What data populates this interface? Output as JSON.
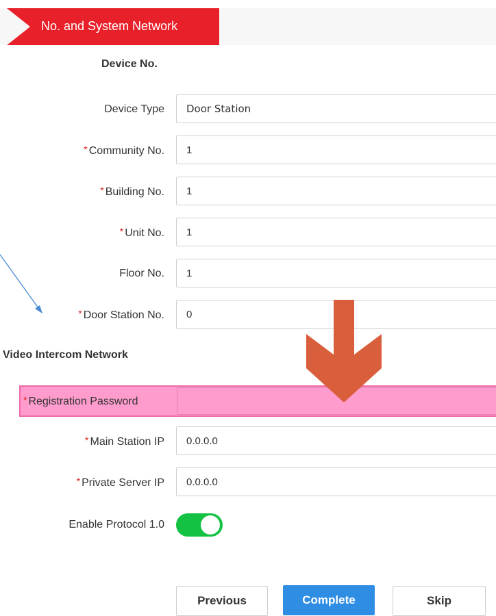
{
  "header": {
    "title": "No. and System Network",
    "accent_color": "#e8202a"
  },
  "device_no": {
    "section_title": "Device No.",
    "fields": [
      {
        "label": "Device Type",
        "required": false,
        "value": "Door Station"
      },
      {
        "label": "Community No.",
        "required": true,
        "value": "1"
      },
      {
        "label": "Building No.",
        "required": true,
        "value": "1"
      },
      {
        "label": "Unit No.",
        "required": true,
        "value": "1"
      },
      {
        "label": "Floor No.",
        "required": false,
        "value": "1"
      },
      {
        "label": "Door Station No.",
        "required": true,
        "value": "0"
      }
    ]
  },
  "video_intercom": {
    "section_title": "Video Intercom Network",
    "registration_password": {
      "label": "Registration Password",
      "required": true,
      "value": ""
    },
    "main_station_ip": {
      "label": "Main Station IP",
      "required": true,
      "value": "0.0.0.0"
    },
    "private_server_ip": {
      "label": "Private Server IP",
      "required": true,
      "value": "0.0.0.0"
    },
    "enable_protocol": {
      "label": "Enable Protocol 1.0",
      "enabled": true
    }
  },
  "required_marker": "*",
  "buttons": {
    "previous": "Previous",
    "complete": "Complete",
    "skip": "Skip"
  },
  "annotations": {
    "highlight_color": "#ff9ccd",
    "arrow_color": "#d95f3c",
    "pointer_line_color": "#4a8ad0"
  },
  "colors": {
    "toggle_on": "#14c243",
    "primary_button": "#2f8de4",
    "required_star": "#e02020"
  }
}
